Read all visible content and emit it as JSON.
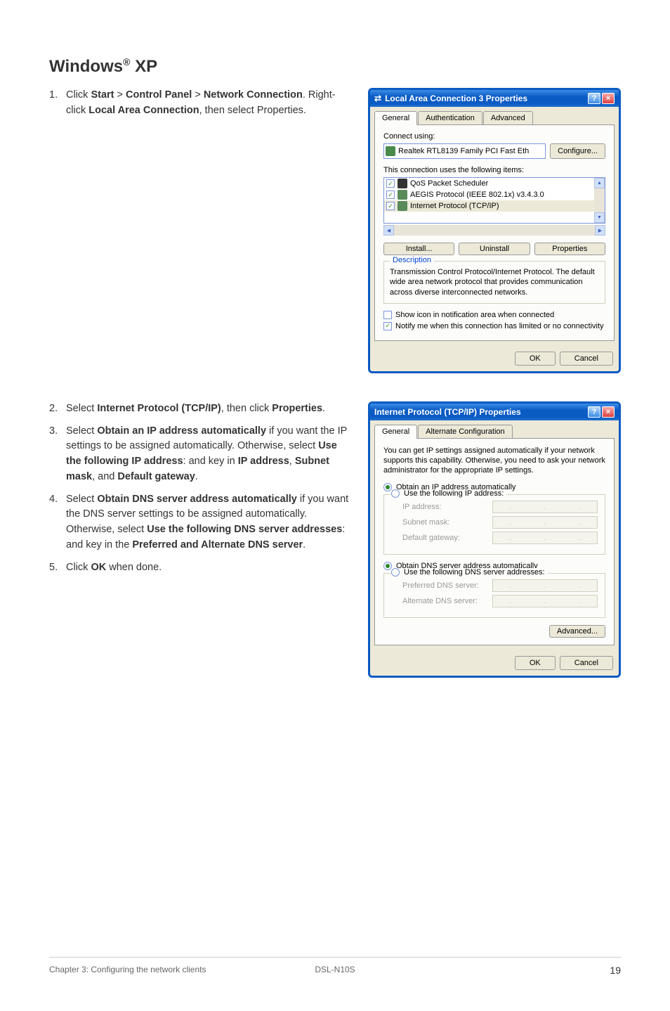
{
  "heading": "Windows® XP",
  "step1": {
    "num": "1.",
    "text_parts": [
      "Click ",
      "Start",
      " > ",
      "Control Panel",
      " > ",
      "Network Connection",
      ". Right-click ",
      "Local Area Connection",
      ", then select Properties."
    ]
  },
  "step2": {
    "num": "2.",
    "parts": [
      "Select ",
      "Internet Protocol (TCP/IP)",
      ", then click ",
      "Properties",
      "."
    ]
  },
  "step3": {
    "num": "3.",
    "parts": [
      "Select ",
      "Obtain an IP address automatically",
      " if you want the IP settings to be assigned automatically. Otherwise, select ",
      "Use the following IP address",
      ": and key in ",
      "IP address",
      ", ",
      "Subnet mask",
      ", and ",
      "Default gateway",
      "."
    ]
  },
  "step4": {
    "num": "4.",
    "parts": [
      "Select ",
      "Obtain DNS server address automatically",
      " if you want the DNS server settings to be assigned automatically. Otherwise, select ",
      "Use the following DNS server addresses",
      ": and key in the ",
      "Preferred and Alternate DNS server",
      "."
    ]
  },
  "step5": {
    "num": "5.",
    "parts": [
      "Click ",
      "OK",
      " when done."
    ]
  },
  "dialog1": {
    "title": "Local Area Connection 3 Properties",
    "tabs": [
      "General",
      "Authentication",
      "Advanced"
    ],
    "connect_using_label": "Connect using:",
    "adapter": "Realtek RTL8139 Family PCI Fast Eth",
    "configure_btn": "Configure...",
    "items_label": "This connection uses the following items:",
    "items": [
      {
        "checked": true,
        "label": "QoS Packet Scheduler"
      },
      {
        "checked": true,
        "label": "AEGIS Protocol (IEEE 802.1x) v3.4.3.0"
      },
      {
        "checked": true,
        "label": "Internet Protocol (TCP/IP)",
        "selected": true
      }
    ],
    "install_btn": "Install...",
    "uninstall_btn": "Uninstall",
    "properties_btn": "Properties",
    "description_label": "Description",
    "description_text": "Transmission Control Protocol/Internet Protocol. The default wide area network protocol that provides communication across diverse interconnected networks.",
    "show_icon": "Show icon in notification area when connected",
    "show_icon_checked": false,
    "notify": "Notify me when this connection has limited or no connectivity",
    "notify_checked": true,
    "ok_btn": "OK",
    "cancel_btn": "Cancel"
  },
  "dialog2": {
    "title": "Internet Protocol (TCP/IP) Properties",
    "tabs": [
      "General",
      "Alternate Configuration"
    ],
    "intro": "You can get IP settings assigned automatically if your network supports this capability. Otherwise, you need to ask your network administrator for the appropriate IP settings.",
    "obtain_ip": "Obtain an IP address automatically",
    "use_ip": "Use the following IP address:",
    "ip_address_label": "IP address:",
    "subnet_label": "Subnet mask:",
    "gateway_label": "Default gateway:",
    "obtain_dns": "Obtain DNS server address automatically",
    "use_dns": "Use the following DNS server addresses:",
    "preferred_dns_label": "Preferred DNS server:",
    "alternate_dns_label": "Alternate DNS server:",
    "advanced_btn": "Advanced...",
    "ok_btn": "OK",
    "cancel_btn": "Cancel"
  },
  "footer": {
    "left": "Chapter 3: Configuring the network clients",
    "center": "DSL-N10S",
    "right": "19"
  }
}
